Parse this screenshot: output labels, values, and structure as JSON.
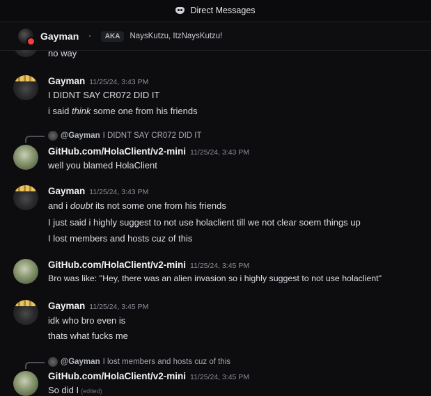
{
  "titlebar": {
    "title": "Direct Messages",
    "icon": "discord-icon"
  },
  "header": {
    "name": "Gayman",
    "aka_label": "AKA",
    "aka_names": "NaysKutzu, ItzNaysKutzu!",
    "status_color": "#f23f43"
  },
  "messages": [
    {
      "lines": [
        "no way"
      ]
    },
    {
      "author": "Gayman",
      "timestamp": "11/25/24, 3:43 PM",
      "lines": [
        "I DIDNT SAY CR072 DID IT"
      ],
      "rich": {
        "pre": "i said ",
        "em": "think",
        "post": " some one from his friends"
      }
    },
    {
      "reply": {
        "mention": "@Gayman",
        "text": "I DIDNT SAY CR072 DID IT"
      },
      "author": "GitHub.com/HolaClient/v2-mini",
      "timestamp": "11/25/24, 3:43 PM",
      "lines": [
        "well you blamed HolaClient"
      ]
    },
    {
      "author": "Gayman",
      "timestamp": "11/25/24, 3:43 PM",
      "rich": {
        "pre": "and i ",
        "em": "doubt",
        "post": " its not some one from his friends"
      },
      "lines": [
        "I just said i highly suggest to not use holaclient till we not clear soem things up",
        "I lost members and hosts cuz of this"
      ]
    },
    {
      "author": "GitHub.com/HolaClient/v2-mini",
      "timestamp": "11/25/24, 3:45 PM",
      "lines": [
        "Bro was like: \"Hey, there was an alien invasion so i highly suggest to not use holaclient\""
      ]
    },
    {
      "author": "Gayman",
      "timestamp": "11/25/24, 3:45 PM",
      "lines": [
        "idk who bro even is",
        "thats what fucks me"
      ]
    },
    {
      "reply": {
        "mention": "@Gayman",
        "text": "I lost members and hosts cuz of this"
      },
      "author": "GitHub.com/HolaClient/v2-mini",
      "timestamp": "11/25/24, 3:45 PM",
      "lines": [
        "So did I"
      ],
      "edited": "(edited)"
    }
  ]
}
